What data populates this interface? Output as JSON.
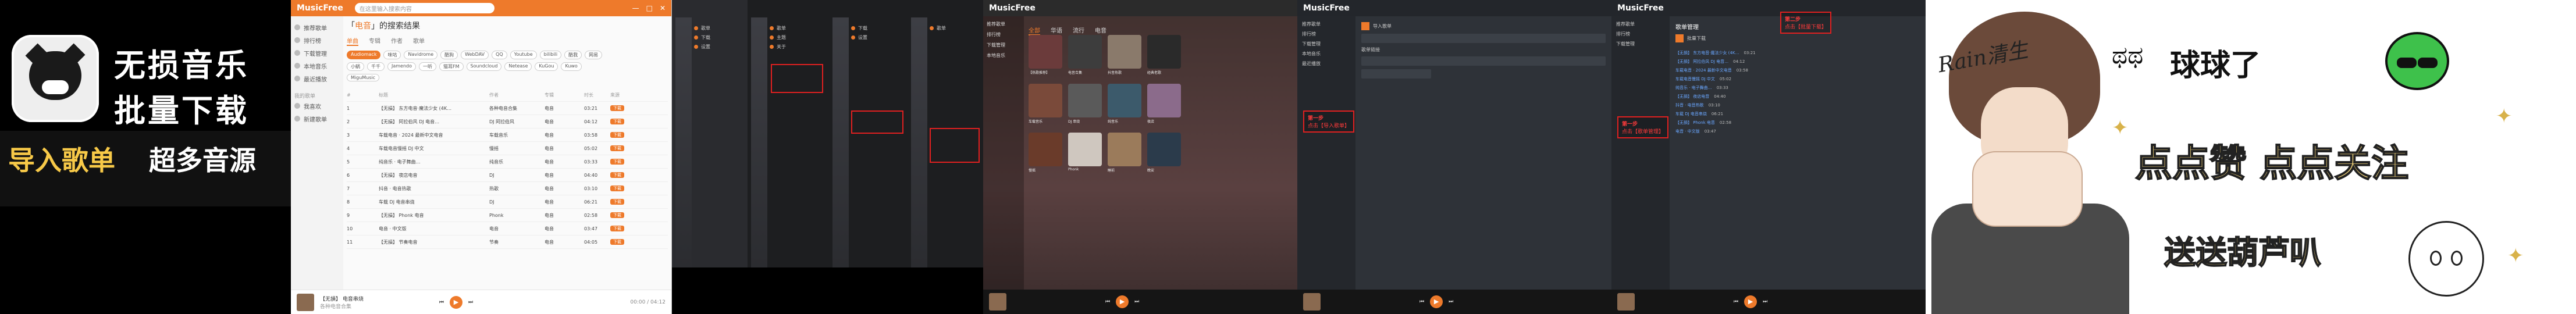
{
  "promo": {
    "line1": "无损音乐",
    "line2": "批量下载",
    "line3": "导入歌单",
    "line4": "超多音源"
  },
  "app": {
    "name": "MusicFree",
    "search_placeholder": "在这里输入搜索内容",
    "window_controls": [
      "—",
      "□",
      "✕"
    ],
    "sidebar": [
      "推荐歌单",
      "排行榜",
      "下载管理",
      "本地音乐",
      "最近播放"
    ],
    "sidebar_section": "我的歌单",
    "sidebar_sub": [
      "我喜欢",
      "新建歌单"
    ],
    "accent": "#ee7a2b"
  },
  "search": {
    "title_prefix": "「",
    "query": "电音",
    "title_suffix": "」的搜索结果",
    "tabs": [
      "单曲",
      "专辑",
      "作者",
      "歌单"
    ],
    "active_tab": 0,
    "sources": [
      "Audiomack",
      "咪咕",
      "Navidrome",
      "酷狗",
      "WebDAV",
      "QQ",
      "Youtube",
      "bilibili",
      "酷我",
      "网易",
      "小蜗",
      "千千",
      "Jamendo",
      "一听",
      "猫耳FM",
      "Soundcloud",
      "Netease",
      "KuGou",
      "Kuwo",
      "MiguMusic"
    ],
    "active_source": 0,
    "headers": [
      "#",
      "标题",
      "作者",
      "专辑",
      "时长",
      "来源"
    ],
    "rows": [
      {
        "n": "1",
        "title": "【无損】 东方电音·魔法少女 (4K…",
        "artist": "各种电音合集",
        "album": "电音",
        "dur": "03:21",
        "src": "B站"
      },
      {
        "n": "2",
        "title": "【无損】 阿拉伯风 DJ 电音…",
        "artist": "DJ 阿拉伯风",
        "album": "电音",
        "dur": "04:12",
        "src": "B站"
      },
      {
        "n": "3",
        "title": "车载电音 · 2024 最新中文电音",
        "artist": "车载音乐",
        "album": "电音",
        "dur": "03:58",
        "src": "B站"
      },
      {
        "n": "4",
        "title": "车载电音慢摇 DJ 中文",
        "artist": "慢摇",
        "album": "电音",
        "dur": "05:02",
        "src": "B站"
      },
      {
        "n": "5",
        "title": "纯音乐 · 电子舞曲…",
        "artist": "纯音乐",
        "album": "电音",
        "dur": "03:33",
        "src": "B站"
      },
      {
        "n": "6",
        "title": "【无損】 夜店电音",
        "artist": "DJ",
        "album": "电音",
        "dur": "04:40",
        "src": "B站"
      },
      {
        "n": "7",
        "title": "抖音 · 电音热歌",
        "artist": "热歌",
        "album": "电音",
        "dur": "03:10",
        "src": "B站"
      },
      {
        "n": "8",
        "title": "车载 DJ 电音串烧",
        "artist": "DJ",
        "album": "电音",
        "dur": "06:21",
        "src": "B站"
      },
      {
        "n": "9",
        "title": "【无損】 Phonk 电音",
        "artist": "Phonk",
        "album": "电音",
        "dur": "02:58",
        "src": "B站"
      },
      {
        "n": "10",
        "title": "电音 · 中文版",
        "artist": "电音",
        "album": "电音",
        "dur": "03:47",
        "src": "B站"
      },
      {
        "n": "11",
        "title": "【无損】 节奏电音",
        "artist": "节奏",
        "album": "电音",
        "dur": "04:05",
        "src": "B站"
      }
    ],
    "download_label": "下载"
  },
  "player": {
    "song": "【无損】 电音串烧",
    "artist": "各种电音合集",
    "time": "00:00 / 04:12"
  },
  "phones": {
    "menu": [
      "歌单",
      "下载",
      "设置",
      "主题",
      "关于"
    ]
  },
  "gallery": {
    "tabs": [
      "全部",
      "华语",
      "流行",
      "电音"
    ],
    "captions": [
      "【热歌推荐】",
      "电音合集",
      "抖音热歌",
      "经典老歌",
      "车载音乐",
      "DJ 串烧",
      "纯音乐",
      "夜店",
      "慢摇",
      "Phonk",
      "睡前",
      "晚安"
    ],
    "colors": [
      "#6b3b3b",
      "#3d3d3d",
      "#8a7a6b",
      "#2a2a2a",
      "#7a4a3a",
      "#5a5a5a",
      "#3c5a6b",
      "#8b6b8b",
      "#6a3b2a",
      "#cfc7bf",
      "#9b7b5b",
      "#2b3b4b"
    ]
  },
  "dark1": {
    "step_tip": "第一步",
    "step_text": "点击【导入歌单】",
    "labels": [
      "导入歌单",
      "歌单链接",
      "确定"
    ]
  },
  "dark2": {
    "step_tip": "第二步",
    "step_text": "点击【批量下载】",
    "step1_tip": "第一步",
    "step1_text": "点击【歌单管理】",
    "header": "歌单管理",
    "action": "批量下载"
  },
  "character": {
    "signature": "Rain清生",
    "ball_text": "球球了",
    "like_text": "点点赞 点点关注",
    "gift_text": "送送葫芦叭",
    "eyes_glyph": "ಥಥ"
  }
}
